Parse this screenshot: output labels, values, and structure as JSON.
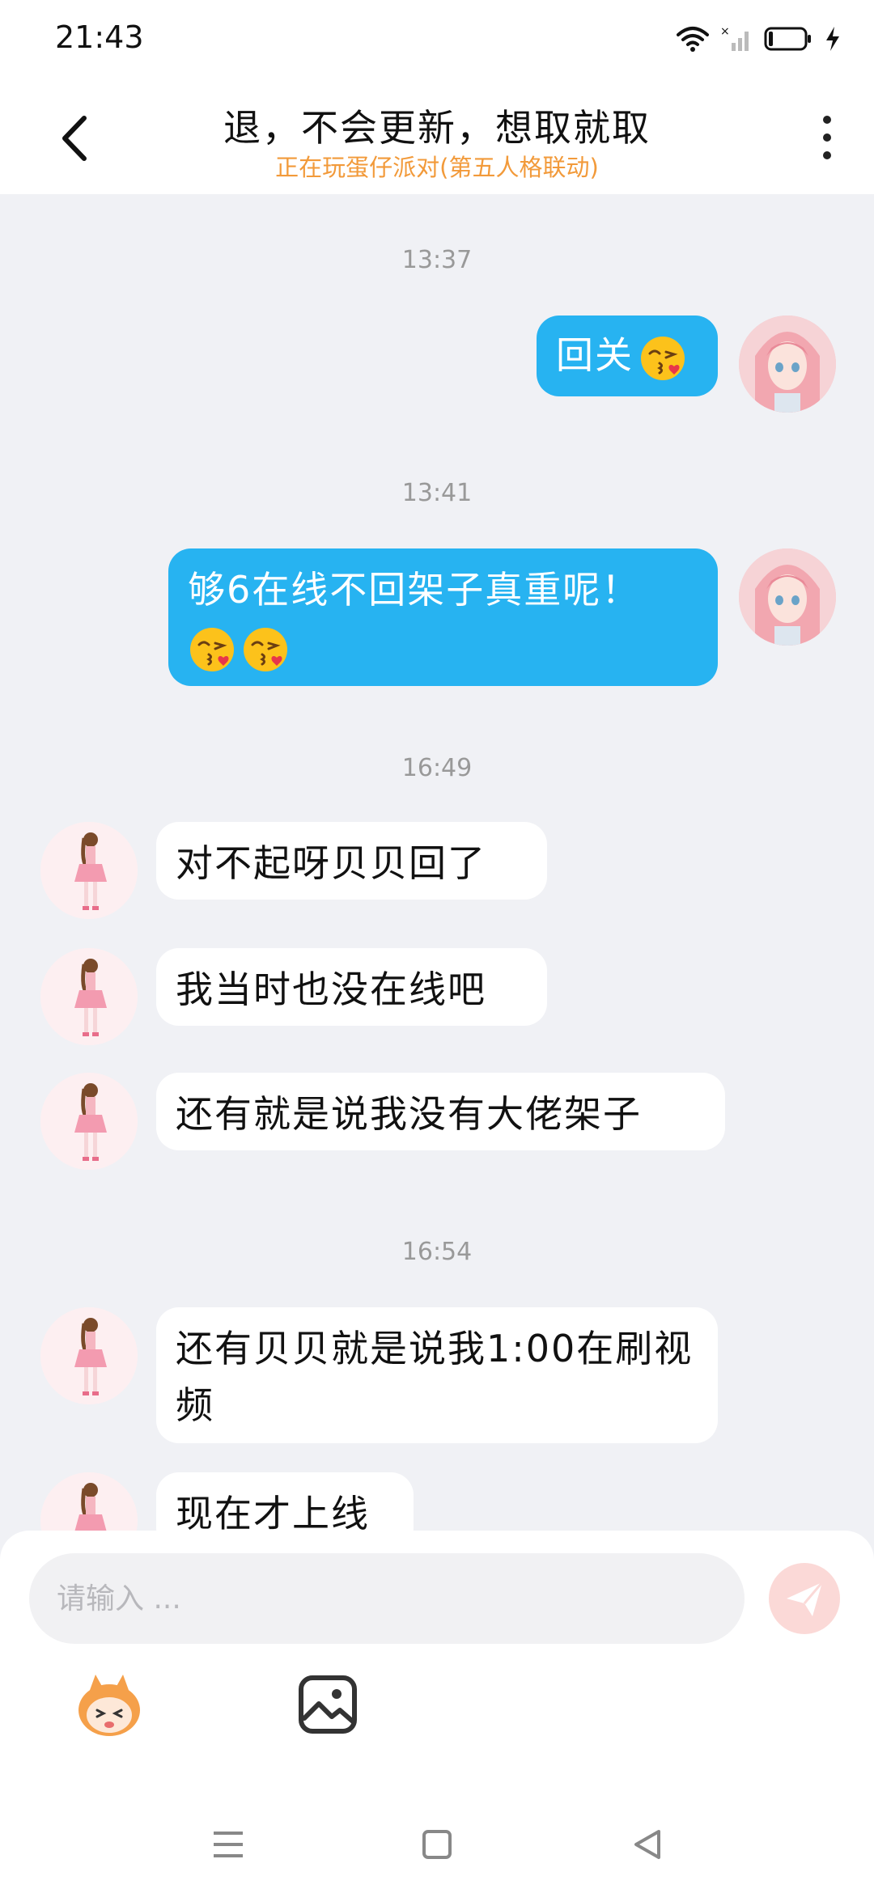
{
  "status_bar": {
    "time": "21:43",
    "icons": [
      "wifi-icon",
      "signal-icon",
      "battery-icon",
      "charging-icon"
    ]
  },
  "header": {
    "title": "退，不会更新，想取就取",
    "subtitle": "正在玩蛋仔派对(第五人格联动)",
    "icons": [
      "back-arrow-icon",
      "more-vert-icon"
    ]
  },
  "messages": [
    {
      "type": "timestamp",
      "text": "13:37"
    },
    {
      "sender": "me",
      "text": "回关",
      "emoji": [
        "kiss-emoji"
      ]
    },
    {
      "type": "timestamp",
      "text": "13:41"
    },
    {
      "sender": "me",
      "text": "够6在线不回架子真重呢！",
      "emoji": [
        "kiss-emoji",
        "kiss-emoji"
      ]
    },
    {
      "type": "timestamp",
      "text": "16:49"
    },
    {
      "sender": "other",
      "text": "对不起呀贝贝回了"
    },
    {
      "sender": "other",
      "text": "我当时也没在线吧"
    },
    {
      "sender": "other",
      "text": "还有就是说我没有大佬架子"
    },
    {
      "type": "timestamp",
      "text": "16:54"
    },
    {
      "sender": "other",
      "text": "还有贝贝就是说我1:00在刷视频"
    },
    {
      "sender": "other",
      "text": "现在才上线"
    }
  ],
  "input": {
    "placeholder": "请输入 ..."
  },
  "toolbar": {
    "icons": [
      "mascot-emoji-icon",
      "image-icon"
    ]
  },
  "send_button": {
    "icon": "send-icon"
  },
  "nav_bar": {
    "icons": [
      "menu-icon",
      "home-square-icon",
      "back-triangle-icon"
    ]
  },
  "colors": {
    "my_bubble": "#27b3f1",
    "other_bubble": "#ffffff",
    "background": "#f0f1f5",
    "subtitle": "#f29a3a",
    "send_button": "#fbd9d7"
  }
}
